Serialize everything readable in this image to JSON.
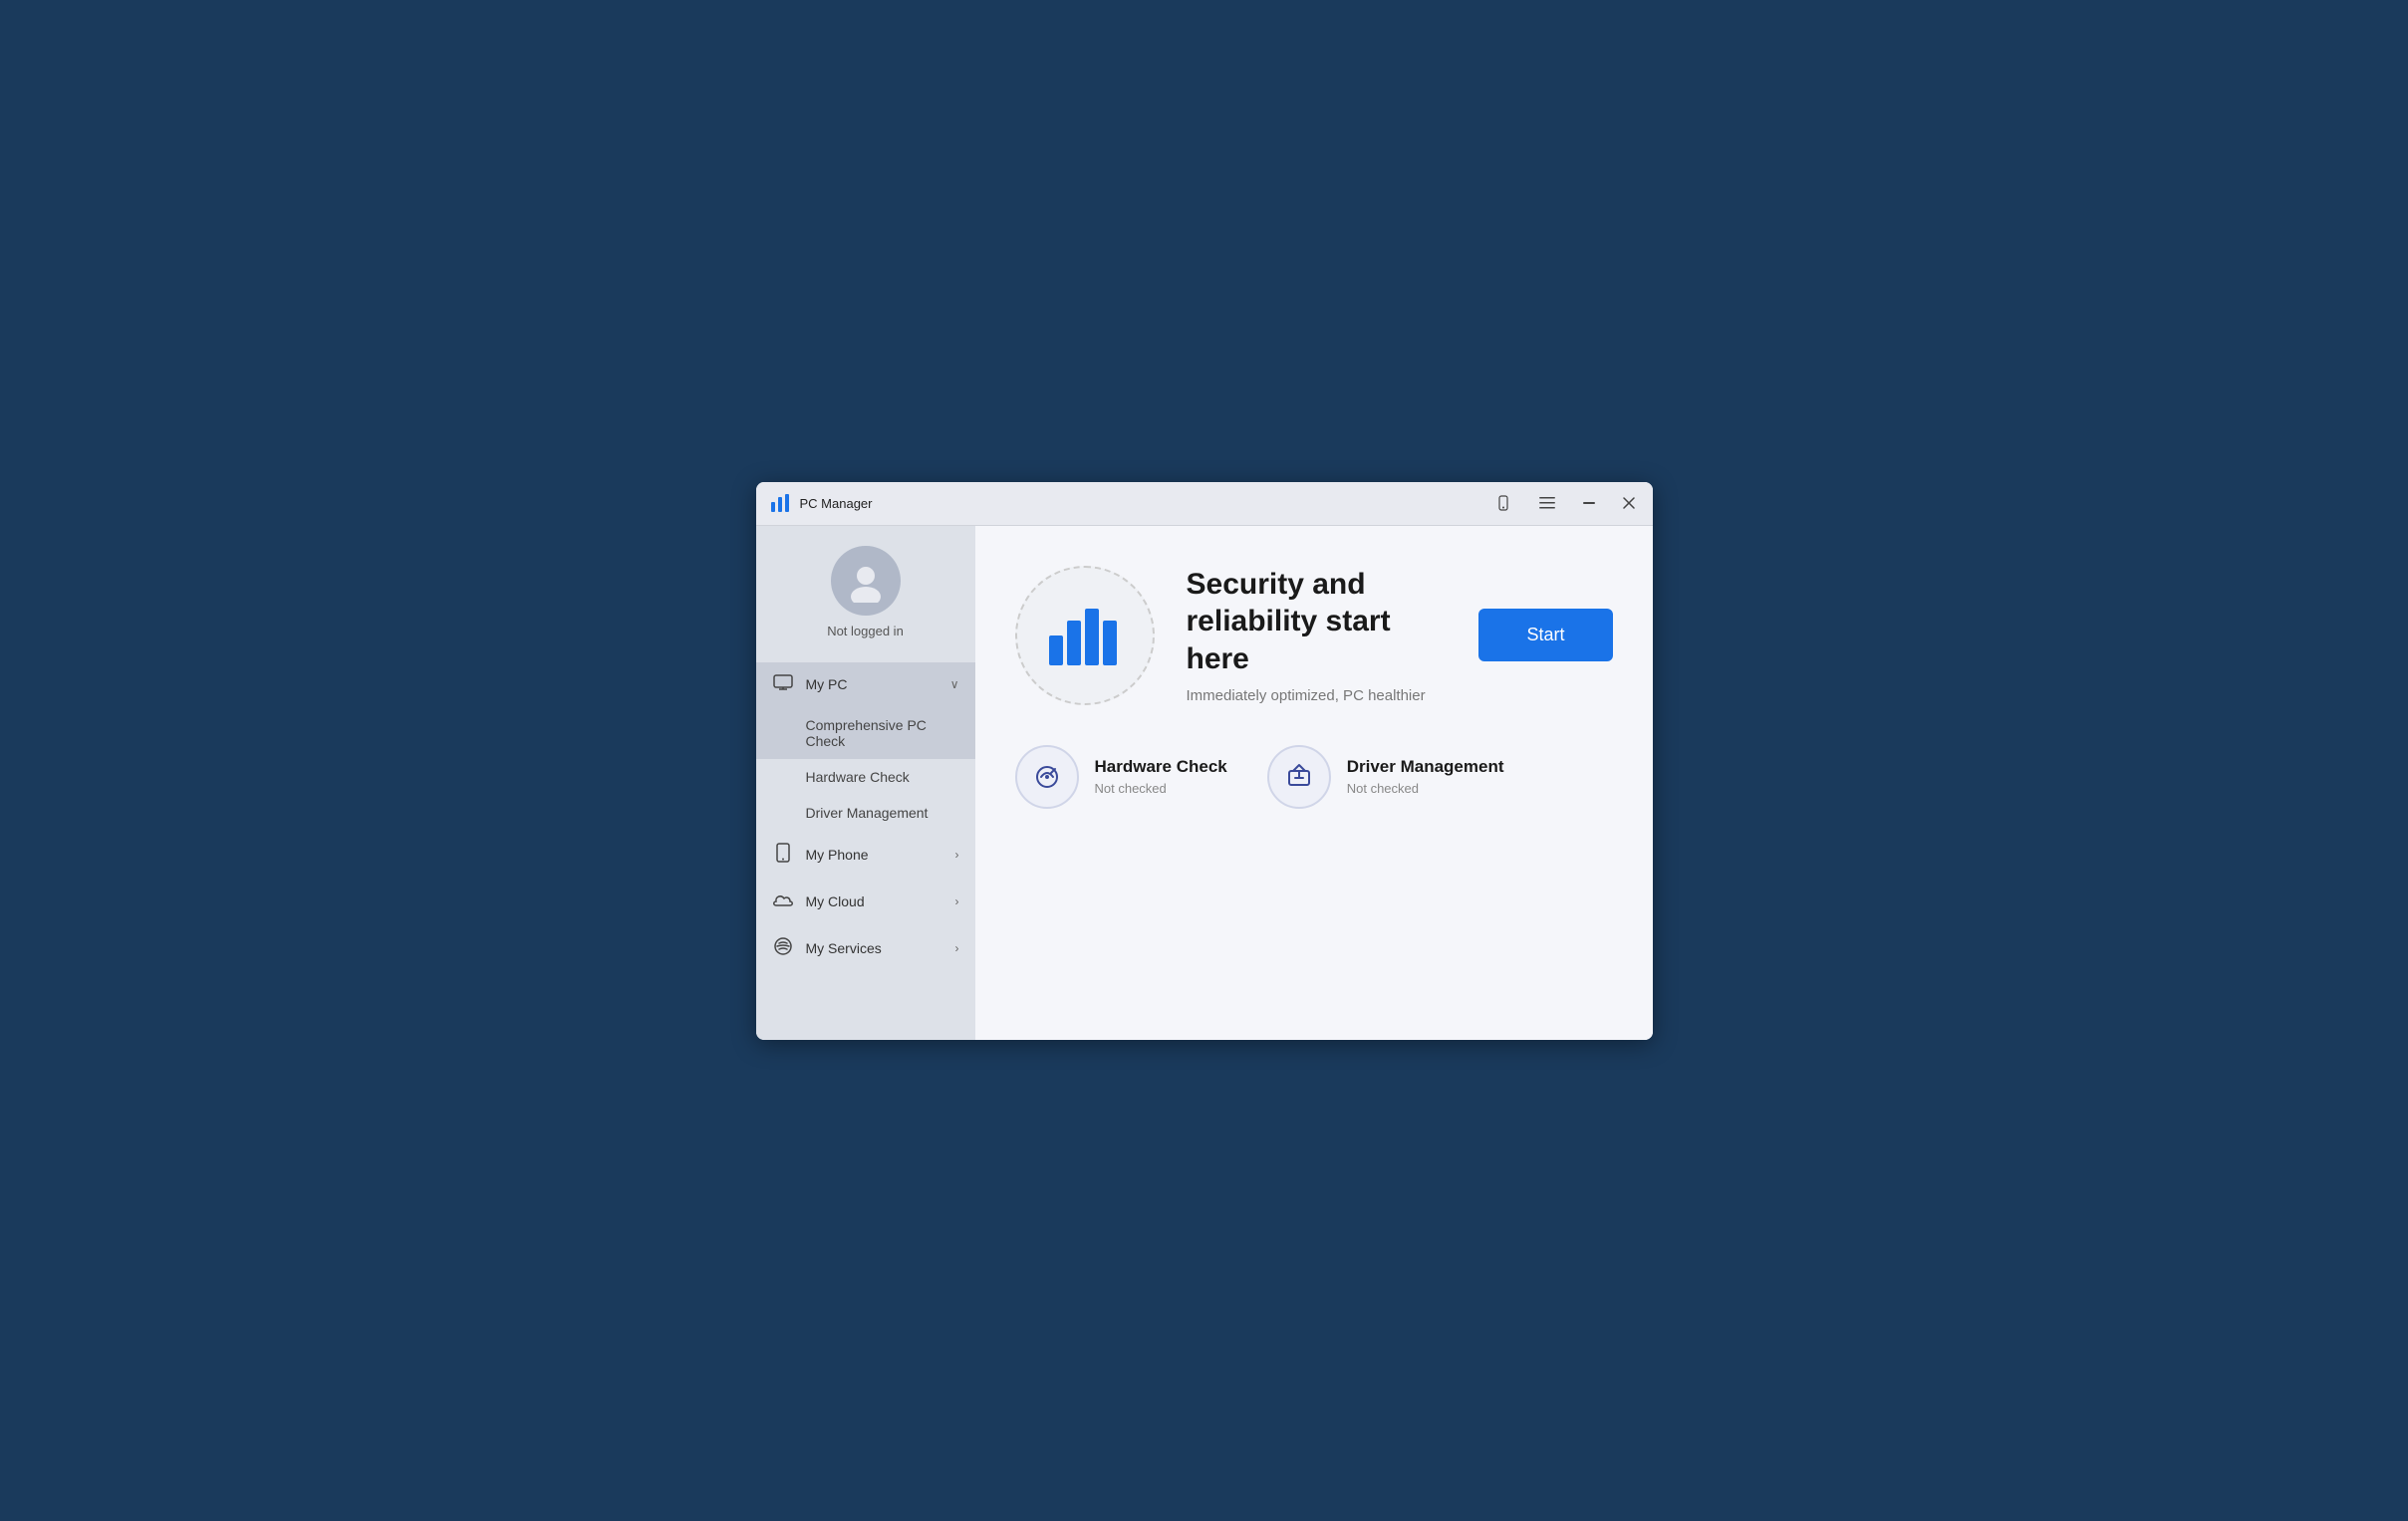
{
  "titlebar": {
    "logo_symbol": "▐▌",
    "title": "PC Manager",
    "phone_icon": "📱",
    "menu_icon": "☰",
    "minimize_icon": "─",
    "close_icon": "✕"
  },
  "sidebar": {
    "profile": {
      "status": "Not logged in"
    },
    "nav_items": [
      {
        "id": "my-pc",
        "icon": "🖥",
        "label": "My PC",
        "expanded": true,
        "chevron": "∨",
        "subitems": [
          {
            "id": "comprehensive",
            "label": "Comprehensive PC Check",
            "active": true
          },
          {
            "id": "hardware",
            "label": "Hardware Check",
            "active": false
          },
          {
            "id": "driver",
            "label": "Driver Management",
            "active": false
          }
        ]
      },
      {
        "id": "my-phone",
        "icon": "📱",
        "label": "My Phone",
        "expanded": false,
        "chevron": "›"
      },
      {
        "id": "my-cloud",
        "icon": "☁",
        "label": "My Cloud",
        "expanded": false,
        "chevron": "›"
      },
      {
        "id": "my-services",
        "icon": "🎧",
        "label": "My Services",
        "expanded": false,
        "chevron": "›"
      }
    ]
  },
  "content": {
    "hero": {
      "heading": "Security and reliability start here",
      "subtext": "Immediately optimized, PC healthier",
      "start_button": "Start"
    },
    "cards": [
      {
        "id": "hardware-check",
        "title": "Hardware Check",
        "status": "Not checked",
        "icon": "⚙"
      },
      {
        "id": "driver-management",
        "title": "Driver Management",
        "status": "Not checked",
        "icon": "⬆"
      }
    ]
  }
}
